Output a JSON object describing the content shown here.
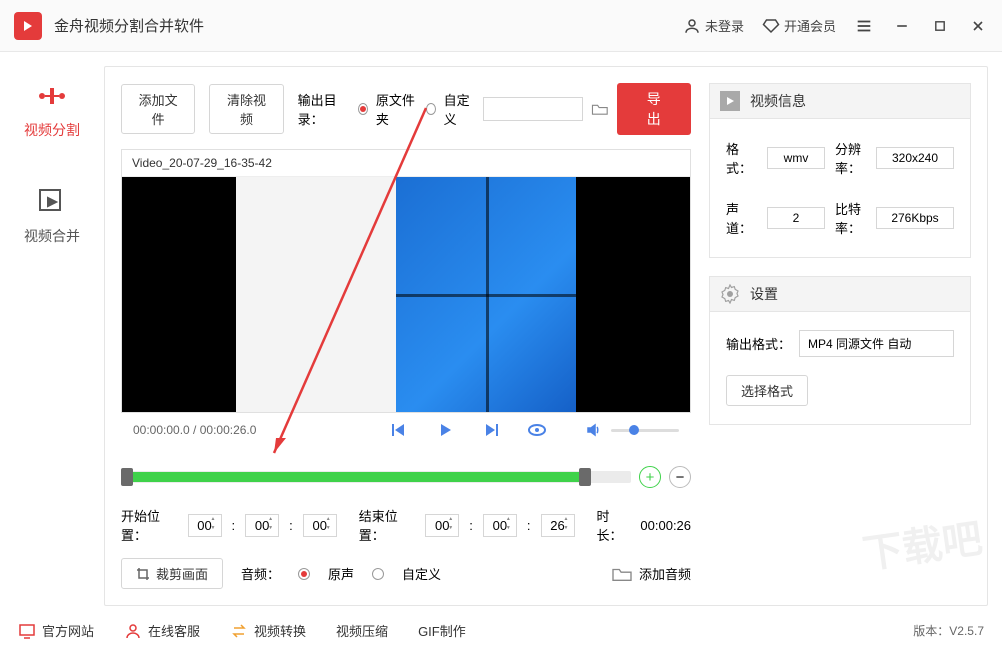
{
  "titlebar": {
    "app_name": "金舟视频分割合并软件",
    "login": "未登录",
    "vip": "开通会员"
  },
  "sidebar": {
    "split": "视频分割",
    "merge": "视频合并"
  },
  "toolbar": {
    "add_file": "添加文件",
    "clear_video": "清除视频",
    "output_dir_label": "输出目录：",
    "radio_original": "原文件夹",
    "radio_custom": "自定义",
    "export": "导出"
  },
  "video": {
    "filename": "Video_20-07-29_16-35-42",
    "time_display": "00:00:00.0 / 00:00:26.0"
  },
  "range": {
    "start_label": "开始位置：",
    "end_label": "结束位置：",
    "start": {
      "h": "00",
      "m": "00",
      "s": "00"
    },
    "end": {
      "h": "00",
      "m": "00",
      "s": "26"
    },
    "duration_label": "时长：",
    "duration": "00:00:26"
  },
  "crop": {
    "btn": "裁剪画面",
    "audio_label": "音频：",
    "audio_original": "原声",
    "audio_custom": "自定义",
    "add_audio": "添加音频"
  },
  "info_panel": {
    "title": "视频信息",
    "format_label": "格式：",
    "format": "wmv",
    "res_label": "分辨率：",
    "resolution": "320x240",
    "channel_label": "声道：",
    "channels": "2",
    "bitrate_label": "比特率：",
    "bitrate": "276Kbps"
  },
  "settings_panel": {
    "title": "设置",
    "output_format_label": "输出格式：",
    "output_format": "MP4 同源文件 自动",
    "choose_format": "选择格式"
  },
  "footer": {
    "website": "官方网站",
    "support": "在线客服",
    "convert": "视频转换",
    "compress": "视频压缩",
    "gif": "GIF制作",
    "version_label": "版本：",
    "version": "V2.5.7"
  }
}
